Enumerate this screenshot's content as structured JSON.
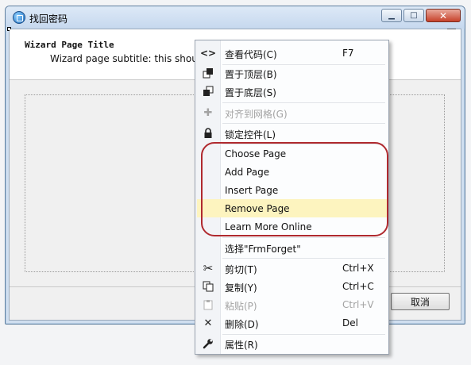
{
  "window": {
    "title": "找回密码",
    "caption": {
      "minimize": "▁",
      "maximize": "□",
      "close": "✕"
    }
  },
  "wizard": {
    "title": "Wizard Page Title",
    "subtitle": "Wizard page subtitle: this should have"
  },
  "footer": {
    "cancel_label": "取消"
  },
  "context_menu": {
    "view_code": {
      "icon": "code-icon",
      "label": "查看代码(C)",
      "shortcut": "F7"
    },
    "bring_to_front": {
      "icon": "bring-to-front-icon",
      "label": "置于顶层(B)"
    },
    "send_to_back": {
      "icon": "send-to-back-icon",
      "label": "置于底层(S)"
    },
    "align_to_grid": {
      "icon": "align-grid-icon",
      "label": "对齐到网格(G)",
      "disabled": true
    },
    "lock_controls": {
      "icon": "lock-icon",
      "label": "锁定控件(L)"
    },
    "choose_page": {
      "label": "Choose Page"
    },
    "add_page": {
      "label": "Add Page"
    },
    "insert_page": {
      "label": "Insert Page"
    },
    "remove_page": {
      "label": "Remove Page",
      "highlighted": true
    },
    "learn_more": {
      "label": "Learn More Online"
    },
    "select_form": {
      "label": "选择\"FrmForget\""
    },
    "cut": {
      "icon": "cut-icon",
      "label": "剪切(T)",
      "shortcut": "Ctrl+X"
    },
    "copy": {
      "icon": "copy-icon",
      "label": "复制(Y)",
      "shortcut": "Ctrl+C"
    },
    "paste": {
      "icon": "paste-icon",
      "label": "粘贴(P)",
      "shortcut": "Ctrl+V",
      "disabled": true
    },
    "delete": {
      "icon": "delete-icon",
      "label": "删除(D)",
      "shortcut": "Del"
    },
    "properties": {
      "icon": "wrench-icon",
      "label": "属性(R)"
    }
  },
  "colors": {
    "menu_highlight": "#fdf4bf",
    "annotation_ring": "#b02a2f",
    "delete_icon": "#d8241b"
  }
}
